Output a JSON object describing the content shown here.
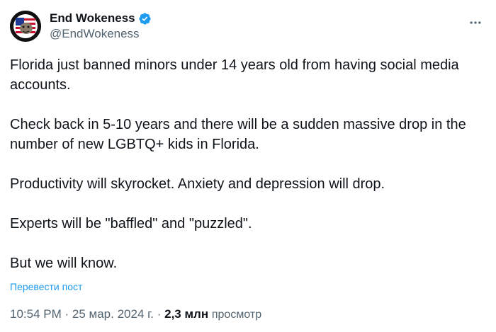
{
  "author": {
    "display_name": "End Wokeness",
    "handle": "@EndWokeness",
    "verified": true,
    "avatar_icon": "end-wokeness-logo",
    "verified_badge_color": "#1d9bf0"
  },
  "tweet": {
    "paragraphs": [
      "Florida just banned minors under 14 years old from having social media accounts.",
      "Check back in 5-10 years and there will be a sudden massive drop in the number of new LGBTQ+ kids in Florida.",
      "Productivity will skyrocket. Anxiety and depression will drop.",
      "Experts will be \"baffled\" and \"puzzled\".",
      "But we will know."
    ],
    "translate_label": "Перевести пост"
  },
  "meta": {
    "time": "10:54 PM",
    "separator": "·",
    "date": "25 мар. 2024 г.",
    "views_count": "2,3 млн",
    "views_label": "просмотр"
  },
  "menu": {
    "more_icon": "more-horizontal-icon"
  },
  "colors": {
    "text_primary": "#0f1419",
    "text_secondary": "#536471",
    "link": "#1d9bf0"
  }
}
